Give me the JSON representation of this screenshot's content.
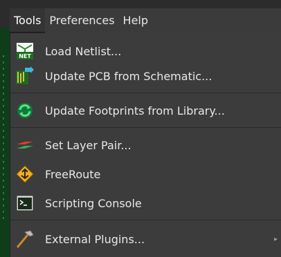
{
  "menubar": {
    "items": [
      {
        "label": "Tools",
        "active": true
      },
      {
        "label": "Preferences",
        "active": false
      },
      {
        "label": "Help",
        "active": false
      }
    ]
  },
  "tools_menu": {
    "items": [
      {
        "label": "Load Netlist...",
        "icon": "netlist-icon"
      },
      {
        "label": "Update PCB from Schematic...",
        "icon": "update-pcb-icon"
      },
      {
        "label": "Update Footprints from Library...",
        "icon": "refresh-icon"
      },
      {
        "label": "Set Layer Pair...",
        "icon": "layer-pair-icon"
      },
      {
        "label": "FreeRoute",
        "icon": "freeroute-icon"
      },
      {
        "label": "Scripting Console",
        "icon": "terminal-icon"
      },
      {
        "label": "External Plugins...",
        "icon": "hammer-icon",
        "submenu": true
      }
    ]
  },
  "colors": {
    "menu_bg": "#3c3c3c",
    "menubar_bg": "#3b3b3b",
    "text": "#e8e8e8"
  }
}
